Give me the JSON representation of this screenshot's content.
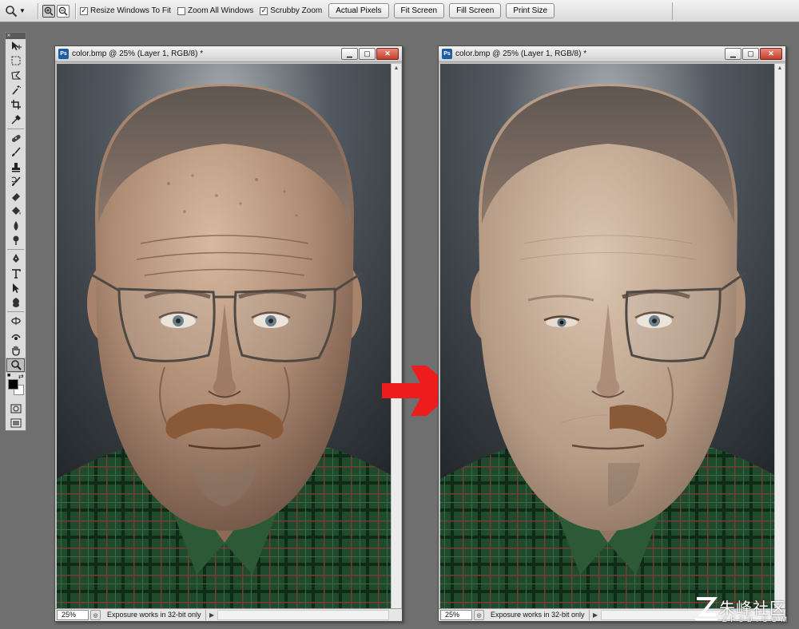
{
  "options_bar": {
    "resize_windows": {
      "label": "Resize Windows To Fit",
      "checked": true
    },
    "zoom_all_windows": {
      "label": "Zoom All Windows",
      "checked": false
    },
    "scrubby_zoom": {
      "label": "Scrubby Zoom",
      "checked": true
    },
    "buttons": {
      "actual_pixels": "Actual Pixels",
      "fit_screen": "Fit Screen",
      "fill_screen": "Fill Screen",
      "print_size": "Print Size"
    }
  },
  "toolbox": {
    "tools": [
      "move-tool",
      "marquee-tool",
      "lasso-tool",
      "quick-selection-tool",
      "crop-tool",
      "eyedropper-tool",
      "spot-healing-tool",
      "brush-tool",
      "clone-stamp-tool",
      "history-brush-tool",
      "eraser-tool",
      "paint-bucket-tool",
      "blur-tool",
      "dodge-tool",
      "pen-tool",
      "type-tool",
      "path-selection-tool",
      "shape-tool",
      "3d-rotate-tool",
      "3d-orbit-tool",
      "hand-tool",
      "zoom-tool"
    ],
    "selected_tool": "zoom-tool",
    "foreground_color": "#000000",
    "background_color": "#ffffff"
  },
  "documents": [
    {
      "title": "color.bmp @ 25% (Layer 1, RGB/8) *",
      "zoom": "25%",
      "status": "Exposure works in 32-bit only",
      "variant": "original"
    },
    {
      "title": "color.bmp @ 25% (Layer 1, RGB/8) *",
      "zoom": "25%",
      "status": "Exposure works in 32-bit only",
      "variant": "edited"
    }
  ],
  "arrow_color": "#ee1c1c",
  "watermark": {
    "name": "朱峰社区",
    "domain": "ZF3D.COM"
  }
}
